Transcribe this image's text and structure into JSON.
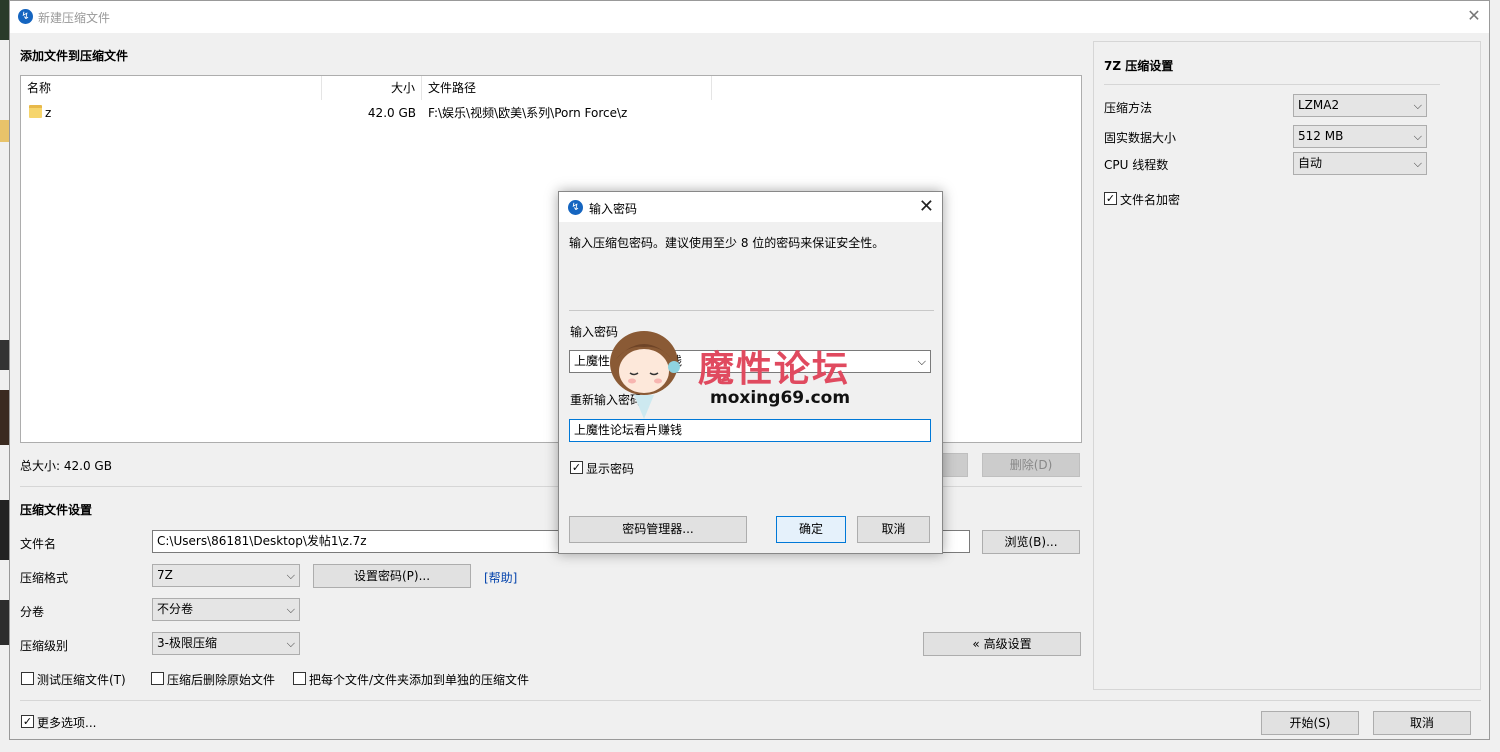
{
  "window": {
    "title": "新建压缩文件",
    "heading": "添加文件到压缩文件"
  },
  "file_list": {
    "columns": [
      "名称",
      "大小",
      "文件路径"
    ],
    "rows": [
      {
        "name": "z",
        "size": "42.0 GB",
        "path": "F:\\娱乐\\视频\\欧美\\系列\\Porn Force\\z"
      }
    ]
  },
  "total_size": "总大小: 42.0 GB",
  "delete_button": "删除(D)",
  "archive_settings": {
    "heading": "压缩文件设置",
    "filename_label": "文件名",
    "filename_value": "C:\\Users\\86181\\Desktop\\发帖1\\z.7z",
    "browse_button": "浏览(B)...",
    "format_label": "压缩格式",
    "format_value": "7Z",
    "set_password_button": "设置密码(P)...",
    "help_link": "[帮助]",
    "split_label": "分卷",
    "split_value": "不分卷",
    "level_label": "压缩级别",
    "level_value": "3-极限压缩",
    "advanced_button": "« 高级设置",
    "test_checkbox": "测试压缩文件(T)",
    "delete_source_checkbox": "压缩后删除原始文件",
    "separate_checkbox": "把每个文件/文件夹添加到单独的压缩文件",
    "more_options_checkbox": "更多选项...",
    "start_button": "开始(S)",
    "cancel_button": "取消"
  },
  "seven_z": {
    "heading": "7Z 压缩设置",
    "method_label": "压缩方法",
    "method_value": "LZMA2",
    "solid_label": "固实数据大小",
    "solid_value": "512 MB",
    "threads_label": "CPU 线程数",
    "threads_value": "自动",
    "encrypt_names_label": "文件名加密",
    "encrypt_names_checked": true
  },
  "password_dialog": {
    "title": "输入密码",
    "instruction": "输入压缩包密码。建议使用至少 8 位的密码来保证安全性。",
    "enter_label": "输入密码",
    "enter_value": "上魔性论坛看片赚钱",
    "reenter_label": "重新输入密码",
    "reenter_value": "上魔性论坛看片赚钱",
    "show_password_label": "显示密码",
    "show_password_checked": true,
    "manager_button": "密码管理器...",
    "ok_button": "确定",
    "cancel_button": "取消"
  },
  "watermark": {
    "text": "魔性论坛",
    "url": "moxing69.com"
  },
  "colors": {
    "accent": "#0078d7",
    "watermark": "#e04a5f"
  }
}
